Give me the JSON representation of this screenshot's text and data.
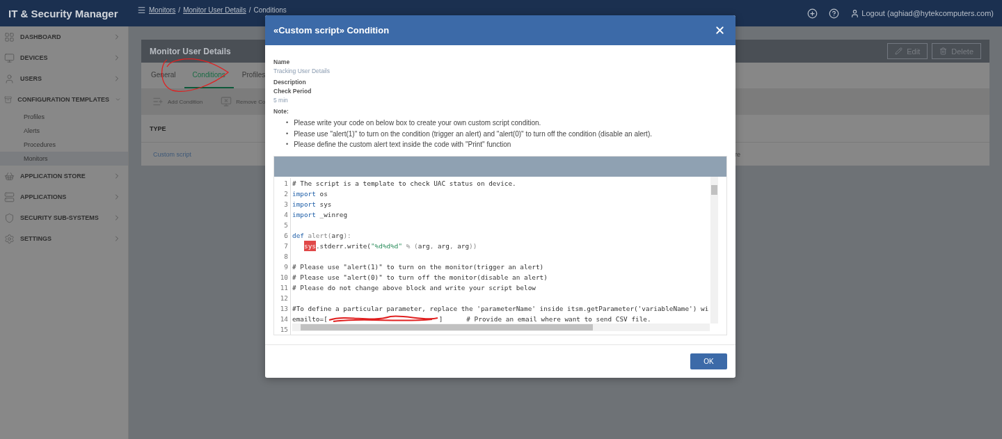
{
  "app": {
    "title": "IT & Security Manager"
  },
  "breadcrumb": [
    {
      "kind": "link",
      "text": "Monitors"
    },
    {
      "kind": "separator",
      "text": "/"
    },
    {
      "kind": "link",
      "text": "Monitor User Details"
    },
    {
      "kind": "separator",
      "text": "/"
    },
    {
      "kind": "current",
      "text": "Conditions"
    }
  ],
  "header": {
    "logout": "Logout (aghiad@hytekcomputers.com)"
  },
  "sidebar": {
    "items": [
      {
        "label": "DASHBOARD",
        "expanded": false
      },
      {
        "label": "DEVICES",
        "expanded": false
      },
      {
        "label": "USERS",
        "expanded": false
      },
      {
        "label": "CONFIGURATION TEMPLATES",
        "expanded": true,
        "children": [
          {
            "label": "Profiles",
            "selected": false
          },
          {
            "label": "Alerts",
            "selected": false
          },
          {
            "label": "Procedures",
            "selected": false
          },
          {
            "label": "Monitors",
            "selected": true
          }
        ]
      },
      {
        "label": "APPLICATION STORE",
        "expanded": false
      },
      {
        "label": "APPLICATIONS",
        "expanded": false
      },
      {
        "label": "SECURITY SUB-SYSTEMS",
        "expanded": false
      },
      {
        "label": "SETTINGS",
        "expanded": false
      }
    ]
  },
  "page": {
    "title": "Monitor User Details",
    "actions": [
      "Edit",
      "Delete"
    ],
    "tabs": [
      {
        "label": "General",
        "selected": false
      },
      {
        "label": "Conditions",
        "selected": true
      },
      {
        "label": "Profiles",
        "selected": false
      }
    ],
    "annotation": {
      "kind": "circle"
    },
    "toolbar": [
      "Add Condition",
      "Remove Co"
    ],
    "table": {
      "columns": [
        "TYPE"
      ],
      "rows": [
        [
          "Custom script",
          "re"
        ]
      ]
    }
  },
  "modal": {
    "title": "«Custom script» Condition",
    "fields": [
      {
        "label": "Name",
        "value": "Tracking User Details"
      },
      {
        "label": "Description"
      },
      {
        "label": "Check Period",
        "value": "5 min"
      }
    ],
    "note_label": "Note:",
    "notes": [
      {
        "marker": "•",
        "text": "Please write your code on below box to create your own custom script condition."
      },
      {
        "marker": "•",
        "text": "Please use \"alert(1)\" to turn on the condition (trigger an alert) and \"alert(0)\" to turn off the condition (disable an alert)."
      },
      {
        "marker": "•",
        "text": "Please define the custom alert text inside the code with \"Print\" function"
      }
    ],
    "code": [
      {
        "number": "1",
        "segments": [
          {
            "kind": "comment",
            "text": "# The script is a template to check UAC status on device."
          }
        ]
      },
      {
        "number": "2",
        "segments": [
          {
            "kind": "keyword",
            "text": "import"
          },
          {
            "kind": "plain",
            "text": " os"
          }
        ]
      },
      {
        "number": "3",
        "segments": [
          {
            "kind": "keyword",
            "text": "import"
          },
          {
            "kind": "plain",
            "text": " sys"
          }
        ]
      },
      {
        "number": "4",
        "segments": [
          {
            "kind": "keyword",
            "text": "import"
          },
          {
            "kind": "plain",
            "text": " _winreg"
          }
        ]
      },
      {
        "number": "5"
      },
      {
        "number": "6",
        "segments": [
          {
            "kind": "keyword",
            "text": "def"
          },
          {
            "kind": "light",
            "text": " alert("
          },
          {
            "kind": "plain",
            "text": "arg"
          },
          {
            "kind": "light",
            "text": "):"
          }
        ]
      },
      {
        "number": "7",
        "indent": true,
        "segments": [
          {
            "kind": "error",
            "text": "sys"
          },
          {
            "kind": "plain",
            "text": ".stderr.write("
          },
          {
            "kind": "string",
            "text": "\"%d%d%d\""
          },
          {
            "kind": "light",
            "text": " % ("
          },
          {
            "kind": "plain",
            "text": "arg"
          },
          {
            "kind": "light",
            "text": ", "
          },
          {
            "kind": "plain",
            "text": "arg"
          },
          {
            "kind": "light",
            "text": ", "
          },
          {
            "kind": "plain",
            "text": "arg"
          },
          {
            "kind": "light",
            "text": "))"
          }
        ]
      },
      {
        "number": "8"
      },
      {
        "number": "9",
        "segments": [
          {
            "kind": "comment",
            "text": "# Please use \"alert(1)\" to turn on the monitor(trigger an alert)"
          }
        ]
      },
      {
        "number": "10",
        "segments": [
          {
            "kind": "comment",
            "text": "# Please use \"alert(0)\" to turn off the monitor(disable an alert)"
          }
        ]
      },
      {
        "number": "11",
        "segments": [
          {
            "kind": "comment",
            "text": "# Please do not change above block and write your script below"
          }
        ]
      },
      {
        "number": "12"
      },
      {
        "number": "13",
        "segments": [
          {
            "kind": "comment",
            "text": "#To define a particular parameter, replace the 'parameterName' inside itsm.getParameter('variableName') wi"
          }
        ]
      },
      {
        "number": "14",
        "segments": [
          {
            "kind": "plain",
            "text": "emailto=["
          },
          {
            "kind": "redaction"
          },
          {
            "kind": "plain",
            "text": "]      # Provide an email where want to send CSV file."
          }
        ]
      },
      {
        "number": "15"
      }
    ],
    "ok": "OK"
  }
}
